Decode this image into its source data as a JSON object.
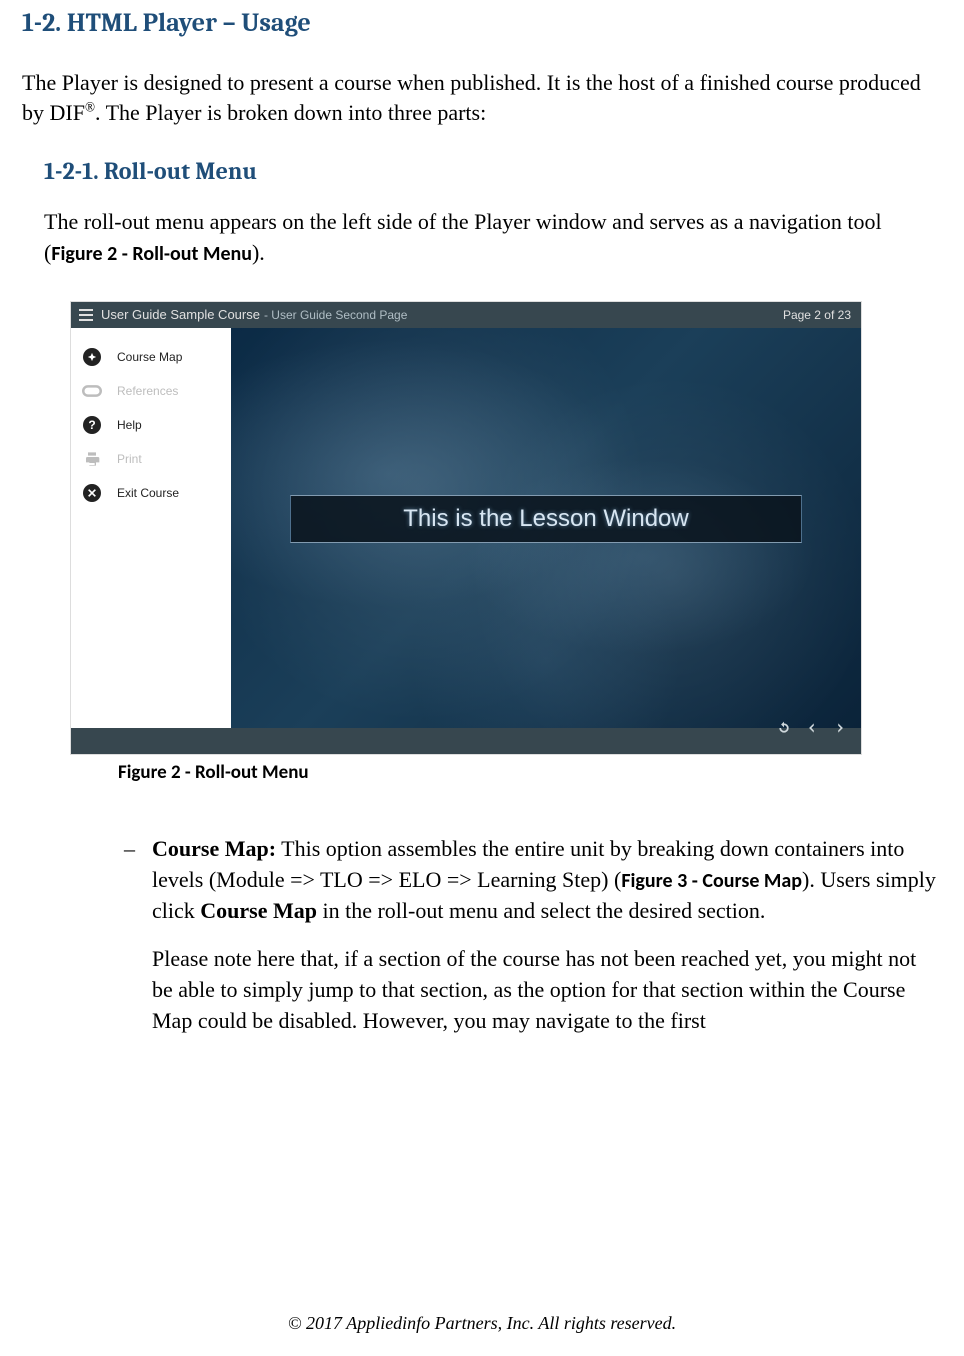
{
  "headings": {
    "h1": "1-2. HTML Player – Usage",
    "h2": "1-2-1. Roll-out Menu"
  },
  "paragraphs": {
    "intro_a": "The Player is designed to present a course when published. It is the host of a finished course produced by DIF",
    "intro_sup": "®",
    "intro_b": ". The Player is broken down into three parts:",
    "rollout_a": "The roll-out menu appears on the left side of the Player window and serves as a navigation tool (",
    "rollout_ref": "Figure 2 - Roll-out Menu",
    "rollout_b": ")."
  },
  "figure": {
    "caption": "Figure 2 - Roll-out Menu",
    "topbar": {
      "title": "User Guide Sample Course",
      "subtitle": " - User Guide Second Page",
      "pageinfo": "Page 2 of 23"
    },
    "menu": {
      "course_map": "Course Map",
      "references": "References",
      "help": "Help",
      "print": "Print",
      "exit": "Exit Course"
    },
    "lesson_label": "This is the Lesson Window"
  },
  "bullets": {
    "cm_lead": "Course Map:",
    "cm_1a": " This option assembles the entire unit by breaking down containers into levels (Module => TLO => ELO => Learning Step) (",
    "cm_1ref": "Figure 3 - Course Map",
    "cm_1b": "). Users simply click ",
    "cm_bold": "Course Map",
    "cm_1c": " in the roll-out menu and select the desired section.",
    "cm_p2": "Please note here that, if a section of the course has not been reached yet, you might not be able to simply jump to that section, as the option for that section within the Course Map could be disabled. However, you may navigate to the first"
  },
  "footer": "© 2017 Appliedinfo Partners, Inc. All rights reserved."
}
